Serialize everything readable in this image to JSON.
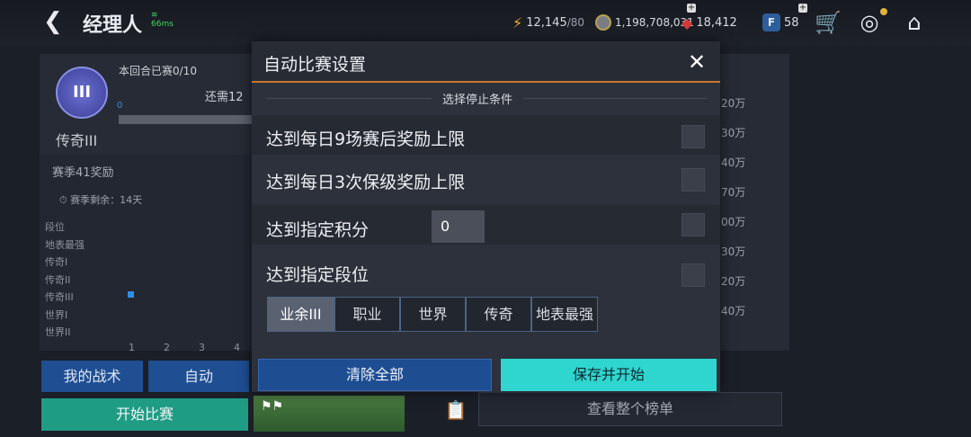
{
  "header": {
    "title": "经理人",
    "ping": "66ms",
    "energy": "12,145",
    "energy_max": "/80",
    "coins": "1,198,708,031",
    "gems": "18,412",
    "f_points": "58",
    "f_letter": "F"
  },
  "left": {
    "round_progress": "本回合已赛0/10",
    "remain_prefix": "还需12",
    "progress_start": "0",
    "rank_name": "传奇III",
    "rank_emblem_text": "III",
    "season_title": "赛季41奖励",
    "season_remain": "赛季剩余：14天",
    "tiers": [
      "段位",
      "地表最强",
      "传奇I",
      "传奇II",
      "传奇III",
      "世界I",
      "世界II"
    ],
    "x_ticks": [
      "1",
      "2",
      "3",
      "4"
    ],
    "current_tier": "传奇III",
    "tactics_button": "我的战术",
    "auto_button": "自动",
    "start_button": "开始比赛"
  },
  "right": {
    "values": [
      "20万",
      "30万",
      "40万",
      "70万",
      "00万",
      "30万",
      "20万",
      "40万"
    ],
    "board_button": "查看整个榜单"
  },
  "modal": {
    "title": "自动比赛设置",
    "subtitle": "选择停止条件",
    "options": [
      {
        "label": "达到每日9场赛后奖励上限",
        "checked": false
      },
      {
        "label": "达到每日3次保级奖励上限",
        "checked": false
      },
      {
        "label": "达到指定积分",
        "checked": false
      },
      {
        "label": "达到指定段位",
        "checked": false
      }
    ],
    "score_value": "0",
    "tier_segments": [
      "业余III",
      "职业",
      "世界",
      "传奇",
      "地表最强"
    ],
    "selected_segment": "业余III",
    "clear_button": "清除全部",
    "save_button": "保存并开始"
  },
  "colors": {
    "accent_orange": "#c9772e",
    "save_cyan": "#2ed6cf",
    "primary_blue": "#1f4e93",
    "start_teal": "#1f9c84"
  },
  "icons": [
    "back-icon",
    "lightning-icon",
    "coin-icon",
    "gem-icon",
    "f-badge-icon",
    "cart-icon",
    "target-icon",
    "home-icon",
    "close-icon",
    "clipboard-icon"
  ]
}
